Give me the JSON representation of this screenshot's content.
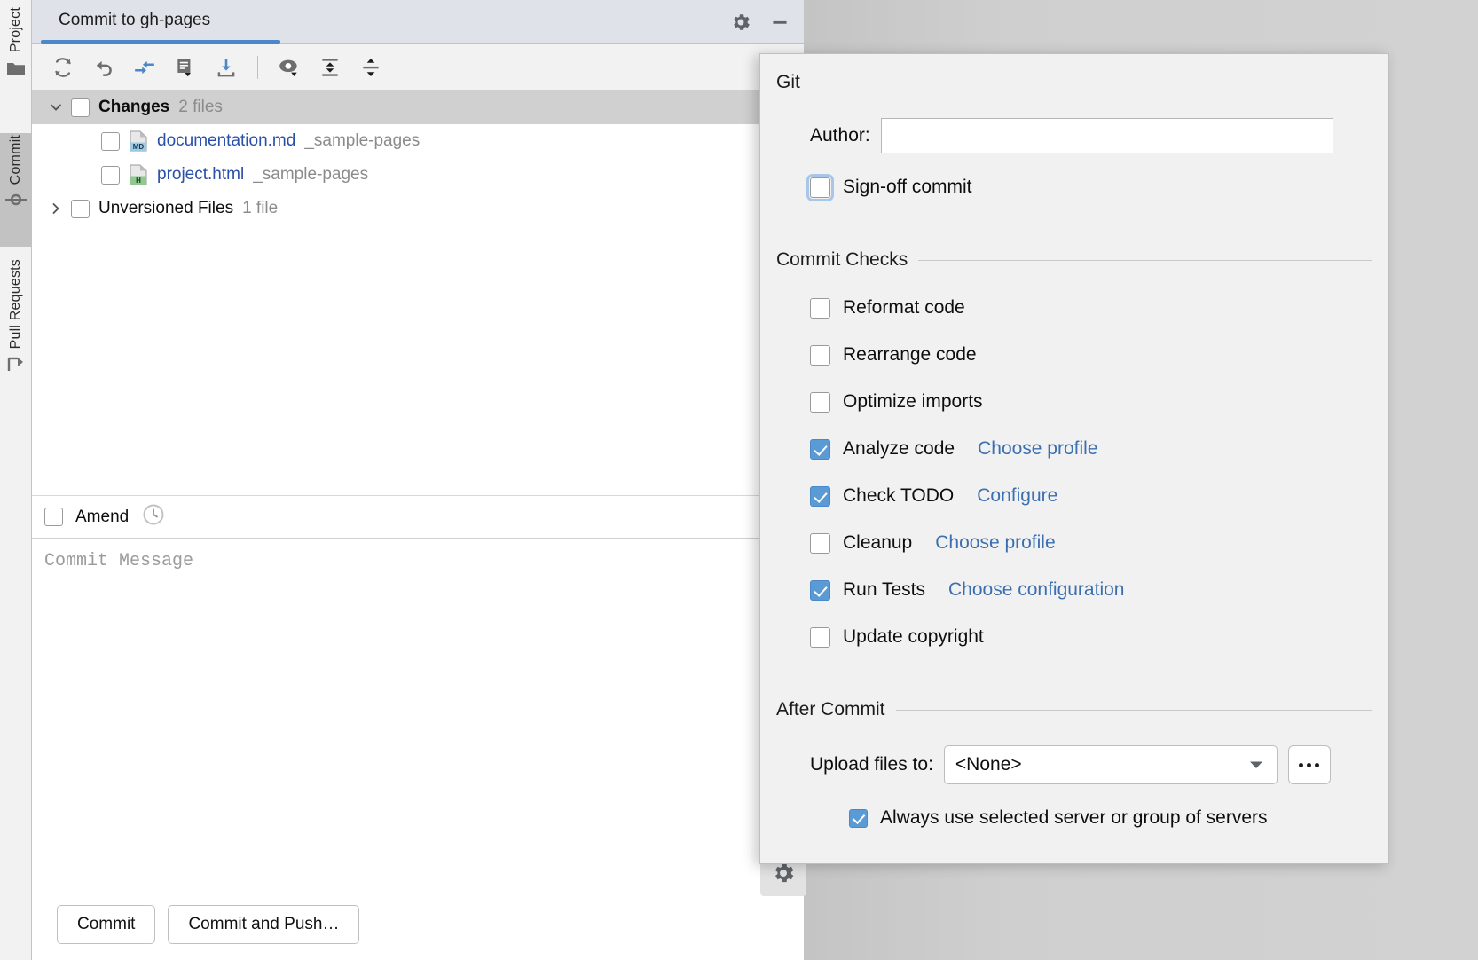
{
  "toolstrip": {
    "tabs": [
      {
        "label": "Project",
        "icon": "folder-icon",
        "selected": false
      },
      {
        "label": "Commit",
        "icon": "commit-node-icon",
        "selected": true
      },
      {
        "label": "Pull Requests",
        "icon": "pull-request-icon",
        "selected": false
      }
    ]
  },
  "commit_window": {
    "title": "Commit to gh-pages",
    "header_icons": [
      {
        "name": "gear-icon"
      },
      {
        "name": "minimize-icon"
      }
    ],
    "toolbar": [
      {
        "name": "refresh-icon",
        "label": "Refresh Changes"
      },
      {
        "name": "rollback-icon",
        "label": "Rollback"
      },
      {
        "name": "move-to-another-changelist-icon",
        "label": "Move to Another Changelist"
      },
      {
        "name": "comment-icon",
        "label": "Show Diff with Comments"
      },
      {
        "name": "shelve-icon",
        "label": "Shelve Silently"
      },
      {
        "name": "preview-diff-icon",
        "label": "Preview Diff"
      },
      {
        "name": "expand-all-icon",
        "label": "Expand All"
      },
      {
        "name": "collapse-all-icon",
        "label": "Collapse All"
      }
    ],
    "tree": {
      "changes": {
        "label": "Changes",
        "count": "2 files",
        "checked": false,
        "expanded": true,
        "selected": true
      },
      "files": [
        {
          "name": "documentation.md",
          "path": "_sample-pages",
          "icon": "markdown-file-icon",
          "badge": "MD",
          "badge_color": "#9ccbe8",
          "checked": false
        },
        {
          "name": "project.html",
          "path": "_sample-pages",
          "icon": "html-file-icon",
          "badge": "H",
          "badge_color": "#8fc98f",
          "checked": false
        }
      ],
      "unversioned": {
        "label": "Unversioned Files",
        "count": "1 file",
        "checked": false,
        "expanded": false
      }
    },
    "amend": {
      "label": "Amend",
      "checked": false,
      "history_icon": "clock-icon"
    },
    "message": {
      "placeholder": "Commit Message",
      "value": ""
    },
    "buttons": [
      {
        "label": "Commit",
        "name": "commit-button"
      },
      {
        "label": "Commit and Push…",
        "name": "commit-and-push-button"
      }
    ],
    "bottom_gear": {
      "name": "gear-icon"
    }
  },
  "settings_popup": {
    "git": {
      "title": "Git",
      "author_label": "Author:",
      "author_value": "",
      "author_placeholder": "",
      "sign_off": {
        "label": "Sign-off commit",
        "checked": false,
        "focused": true
      }
    },
    "commit_checks": {
      "title": "Commit Checks",
      "items": [
        {
          "label": "Reformat code",
          "checked": false,
          "link": ""
        },
        {
          "label": "Rearrange code",
          "checked": false,
          "link": ""
        },
        {
          "label": "Optimize imports",
          "checked": false,
          "link": ""
        },
        {
          "label": "Analyze code",
          "checked": true,
          "link": "Choose profile"
        },
        {
          "label": "Check TODO",
          "checked": true,
          "link": "Configure"
        },
        {
          "label": "Cleanup",
          "checked": false,
          "link": "Choose profile"
        },
        {
          "label": "Run Tests",
          "checked": true,
          "link": "Choose configuration"
        },
        {
          "label": "Update copyright",
          "checked": false,
          "link": ""
        }
      ]
    },
    "after_commit": {
      "title": "After Commit",
      "upload_label": "Upload files to:",
      "upload_value": "<None>",
      "more_button_label": "…",
      "always_use": {
        "label": "Always use selected server or group of servers",
        "checked": true
      }
    }
  },
  "colors": {
    "accent_blue": "#4a88c7",
    "checkbox_checked": "#5b9bd5",
    "link_blue": "#3b6fb0",
    "file_link": "#2a4fa8",
    "muted_text": "#8b8b8b",
    "header_bg": "#dfe3e9",
    "popup_bg": "#f1f1f1",
    "selection_bg": "#d0d0d0"
  }
}
